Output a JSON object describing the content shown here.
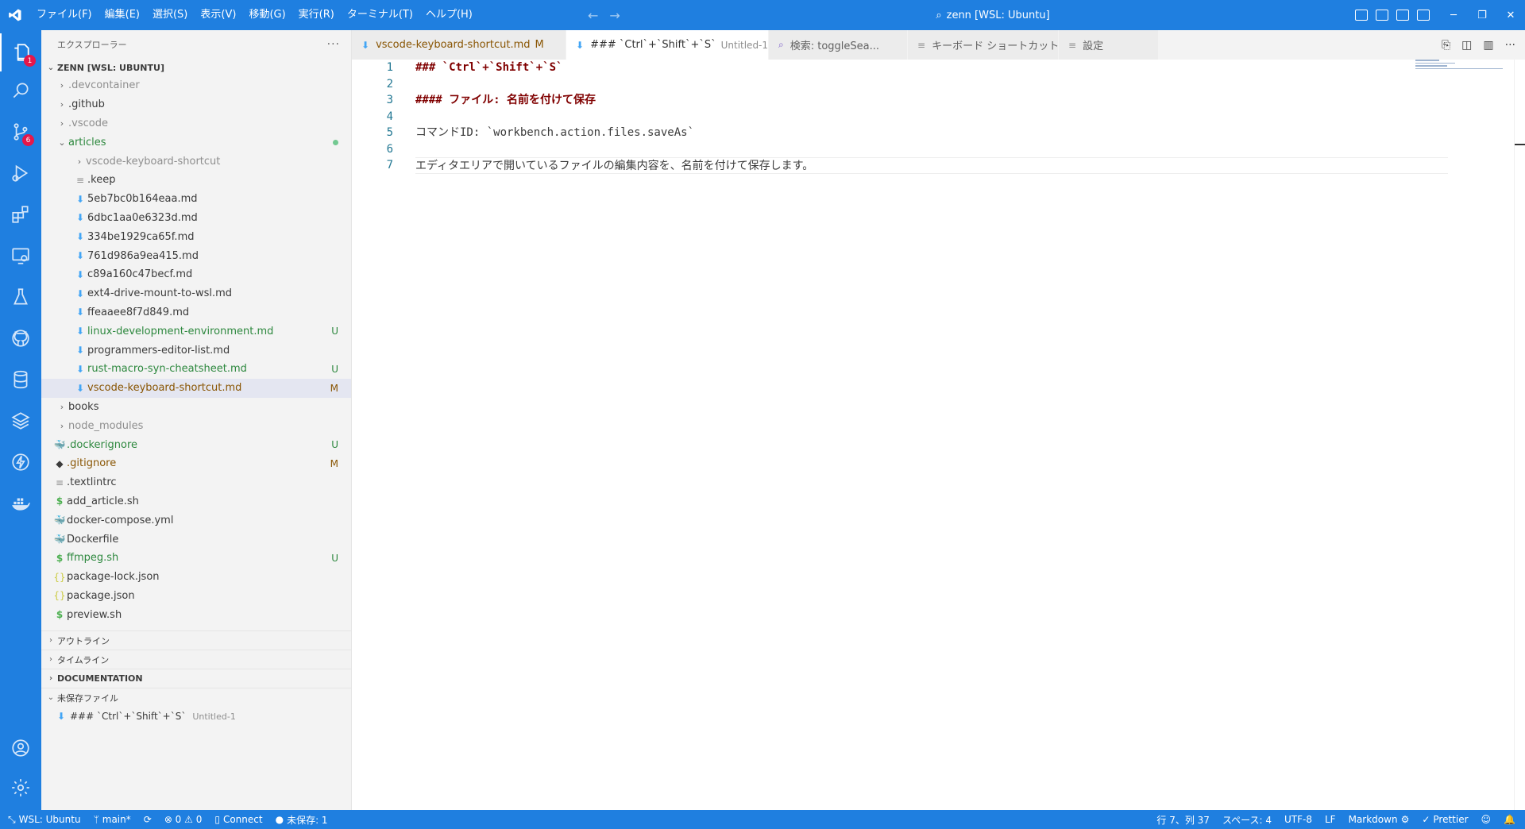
{
  "titlebar": {
    "menu": [
      "ファイル(F)",
      "編集(E)",
      "選択(S)",
      "表示(V)",
      "移動(G)",
      "実行(R)",
      "ターミナル(T)",
      "ヘルプ(H)"
    ],
    "command_center": "zenn [WSL: Ubuntu]"
  },
  "activity_badges": {
    "explorer": "1",
    "source_control": "6"
  },
  "sidebar": {
    "title": "エクスプローラー",
    "more": "···",
    "workspace": "ZENN [WSL: UBUNTU]",
    "tree": [
      {
        "label": ".devcontainer",
        "deco": ""
      },
      {
        "label": ".github",
        "deco": ""
      },
      {
        "label": ".vscode",
        "deco": ""
      },
      {
        "label": "articles",
        "deco": ""
      },
      {
        "label": "vscode-keyboard-shortcut",
        "deco": ""
      },
      {
        "label": ".keep",
        "deco": ""
      },
      {
        "label": "5eb7bc0b164eaa.md",
        "deco": ""
      },
      {
        "label": "6dbc1aa0e6323d.md",
        "deco": ""
      },
      {
        "label": "334be1929ca65f.md",
        "deco": ""
      },
      {
        "label": "761d986a9ea415.md",
        "deco": ""
      },
      {
        "label": "c89a160c47becf.md",
        "deco": ""
      },
      {
        "label": "ext4-drive-mount-to-wsl.md",
        "deco": ""
      },
      {
        "label": "ffeaaee8f7d849.md",
        "deco": ""
      },
      {
        "label": "linux-development-environment.md",
        "deco": "U"
      },
      {
        "label": "programmers-editor-list.md",
        "deco": ""
      },
      {
        "label": "rust-macro-syn-cheatsheet.md",
        "deco": "U"
      },
      {
        "label": "vscode-keyboard-shortcut.md",
        "deco": "M"
      },
      {
        "label": "books",
        "deco": ""
      },
      {
        "label": "node_modules",
        "deco": ""
      },
      {
        "label": ".dockerignore",
        "deco": "U"
      },
      {
        "label": ".gitignore",
        "deco": "M"
      },
      {
        "label": ".textlintrc",
        "deco": ""
      },
      {
        "label": "add_article.sh",
        "deco": ""
      },
      {
        "label": "docker-compose.yml",
        "deco": ""
      },
      {
        "label": "Dockerfile",
        "deco": ""
      },
      {
        "label": "ffmpeg.sh",
        "deco": "U"
      },
      {
        "label": "package-lock.json",
        "deco": ""
      },
      {
        "label": "package.json",
        "deco": ""
      },
      {
        "label": "preview.sh",
        "deco": ""
      }
    ],
    "sections": {
      "outline": "アウトライン",
      "timeline": "タイムライン",
      "documentation": "DOCUMENTATION",
      "unsaved": "未保存ファイル"
    },
    "unsaved_file": {
      "name": "### `Ctrl`+`Shift`+`S`",
      "desc": "Untitled-1"
    }
  },
  "tabs": [
    {
      "label": "vscode-keyboard-shortcut.md",
      "flag": "M"
    },
    {
      "label": "### `Ctrl`+`Shift`+`S`",
      "desc": "Untitled-1"
    },
    {
      "label": "検索: toggleSea..."
    },
    {
      "label": "キーボード ショートカット"
    },
    {
      "label": "設定"
    }
  ],
  "editor": {
    "line_numbers": [
      "1",
      "2",
      "3",
      "4",
      "5",
      "6",
      "7"
    ],
    "lines": [
      "### `Ctrl`+`Shift`+`S`",
      "",
      "#### ファイル: 名前を付けて保存",
      "",
      "コマンドID: `workbench.action.files.saveAs`",
      "",
      "エディタエリアで開いているファイルの編集内容を、名前を付けて保存します。"
    ]
  },
  "statusbar": {
    "remote": "WSL: Ubuntu",
    "branch": "main*",
    "problems": "⊗ 0 ⚠ 0",
    "connect": "Connect",
    "unsaved": "未保存: 1",
    "cursor": "行 7、列 37",
    "indent": "スペース: 4",
    "encoding": "UTF-8",
    "eol": "LF",
    "language": "Markdown",
    "prettier": "Prettier"
  },
  "colors": {
    "accent": "#1f7fe0",
    "git_untracked": "#2d883e",
    "git_modified": "#895503",
    "heading": "#800000"
  }
}
